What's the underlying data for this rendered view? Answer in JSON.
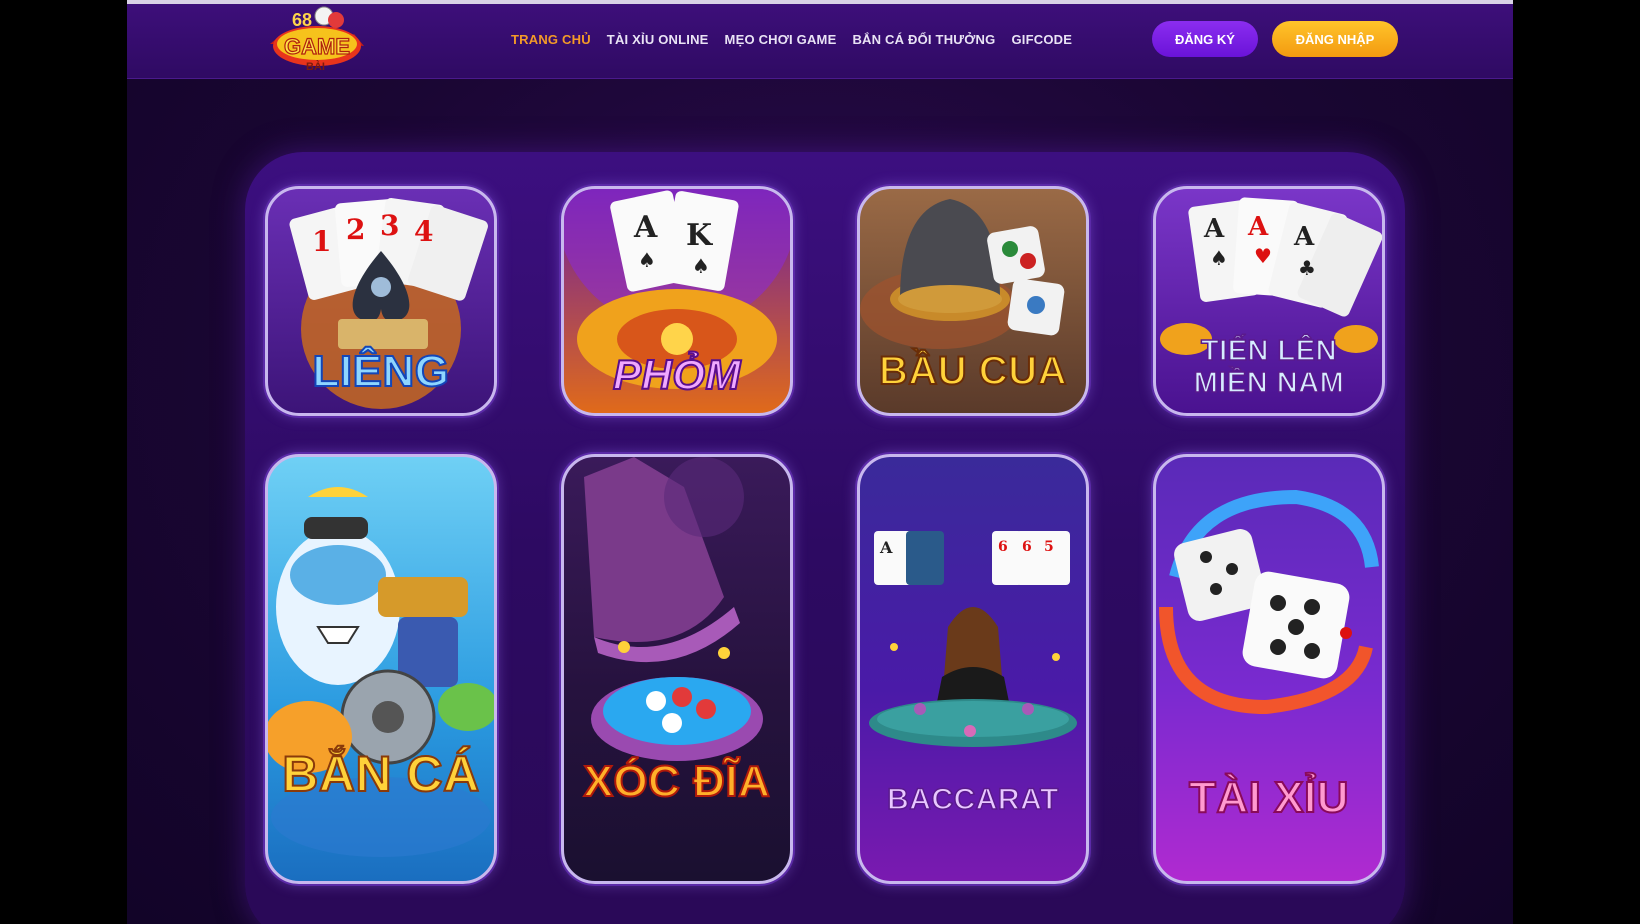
{
  "header": {
    "logo_text": "68 GAME BÀI",
    "nav": [
      {
        "label": "TRANG CHỦ",
        "active": true
      },
      {
        "label": "TÀI XỈU ONLINE",
        "active": false
      },
      {
        "label": "MẸO CHƠI GAME",
        "active": false
      },
      {
        "label": "BẮN CÁ ĐỔI THƯỞNG",
        "active": false
      },
      {
        "label": "GIFCODE",
        "active": false
      }
    ],
    "register_label": "ĐĂNG KÝ",
    "login_label": "ĐĂNG NHẬP"
  },
  "games": [
    {
      "title": "LIÊNG"
    },
    {
      "title": "PHỎM"
    },
    {
      "title": "BẦU CUA"
    },
    {
      "title": "TIẾN LÊN MIỀN NAM"
    },
    {
      "title": "BẮN CÁ"
    },
    {
      "title": "XÓC ĐĨA"
    },
    {
      "title": "BACCARAT"
    },
    {
      "title": "TÀI XỈU"
    }
  ],
  "colors": {
    "nav_active": "#f39a28",
    "register_button": "#7a1de6",
    "login_button": "#f7ab18",
    "panel": "#3c0f80"
  }
}
